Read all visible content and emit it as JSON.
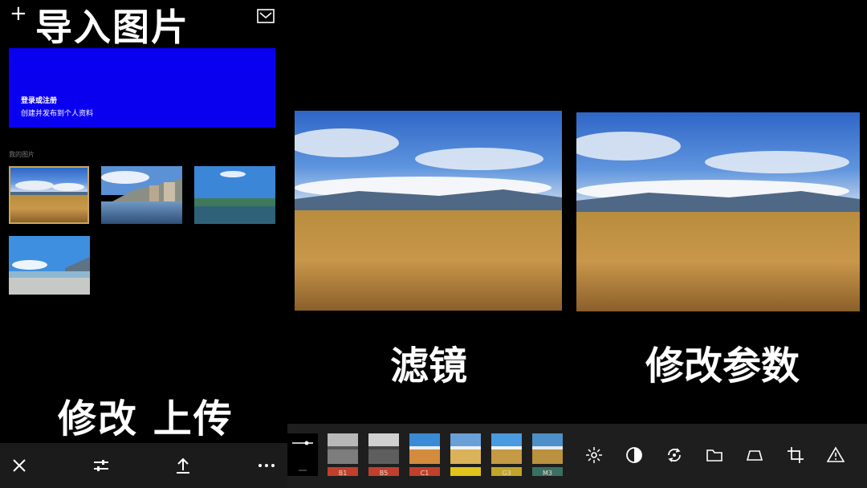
{
  "header": {
    "import_title": "导入图片"
  },
  "login": {
    "title": "登录或注册",
    "subtitle": "创建并发布到个人资料"
  },
  "gallery": {
    "section_label": "我的图片"
  },
  "captions": {
    "edit_upload": "修改 上传",
    "filter": "滤镜",
    "params": "修改参数"
  },
  "filters": [
    {
      "label": "B1",
      "tag_color": "#c0402c"
    },
    {
      "label": "B5",
      "tag_color": "#c0402c"
    },
    {
      "label": "C1",
      "tag_color": "#c0402c"
    },
    {
      "label": "",
      "tag_color": "#e0c41a"
    },
    {
      "label": "G3",
      "tag_color": "#bfa62a"
    },
    {
      "label": "M3",
      "tag_color": "#3a6f63"
    }
  ],
  "toolbar_icons": {
    "left": [
      "close-icon",
      "adjust-sliders-icon",
      "upload-icon",
      "more-icon"
    ],
    "right": [
      "exposure-sun-icon",
      "contrast-icon",
      "rotate-icon",
      "folder-icon",
      "perspective-icon",
      "crop-icon",
      "warning-triangle-icon"
    ]
  },
  "colors": {
    "banner": "#0a00f0",
    "selected_border": "#c8a857"
  }
}
